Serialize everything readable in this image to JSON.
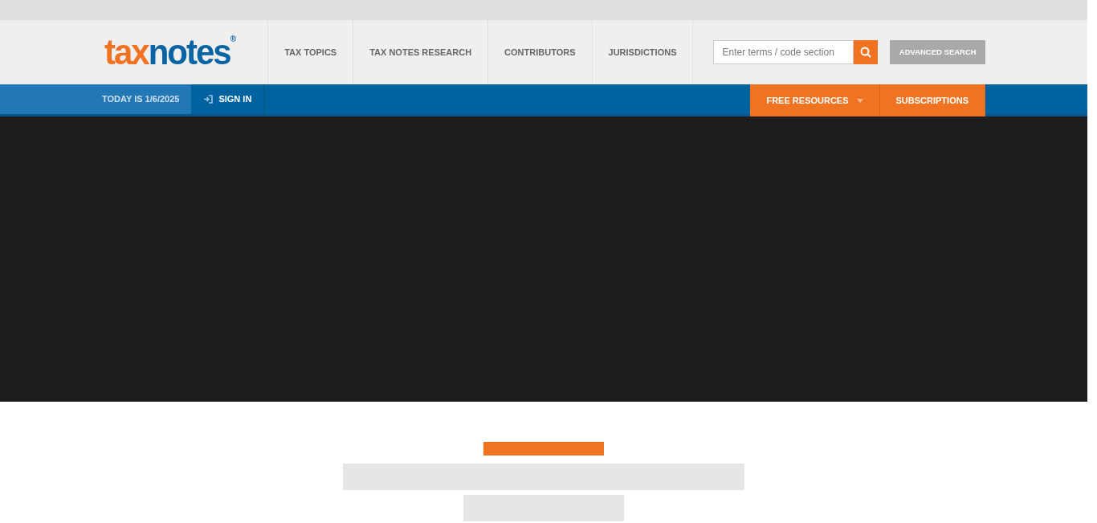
{
  "logo": {
    "part_1": "tax",
    "part_2": "notes",
    "mark": "®"
  },
  "nav": [
    "TAX TOPICS",
    "TAX NOTES RESEARCH",
    "CONTRIBUTORS",
    "JURISDICTIONS"
  ],
  "search": {
    "placeholder": "Enter terms / code section"
  },
  "advanced_search": "ADVANCED SEARCH",
  "date": "TODAY IS 1/6/2025",
  "sign_in": "SIGN IN",
  "menu": [
    {
      "label": "FREE RESOURCES",
      "kind": "dropdown"
    },
    {
      "label": "SUBSCRIPTIONS",
      "kind": "link"
    }
  ]
}
